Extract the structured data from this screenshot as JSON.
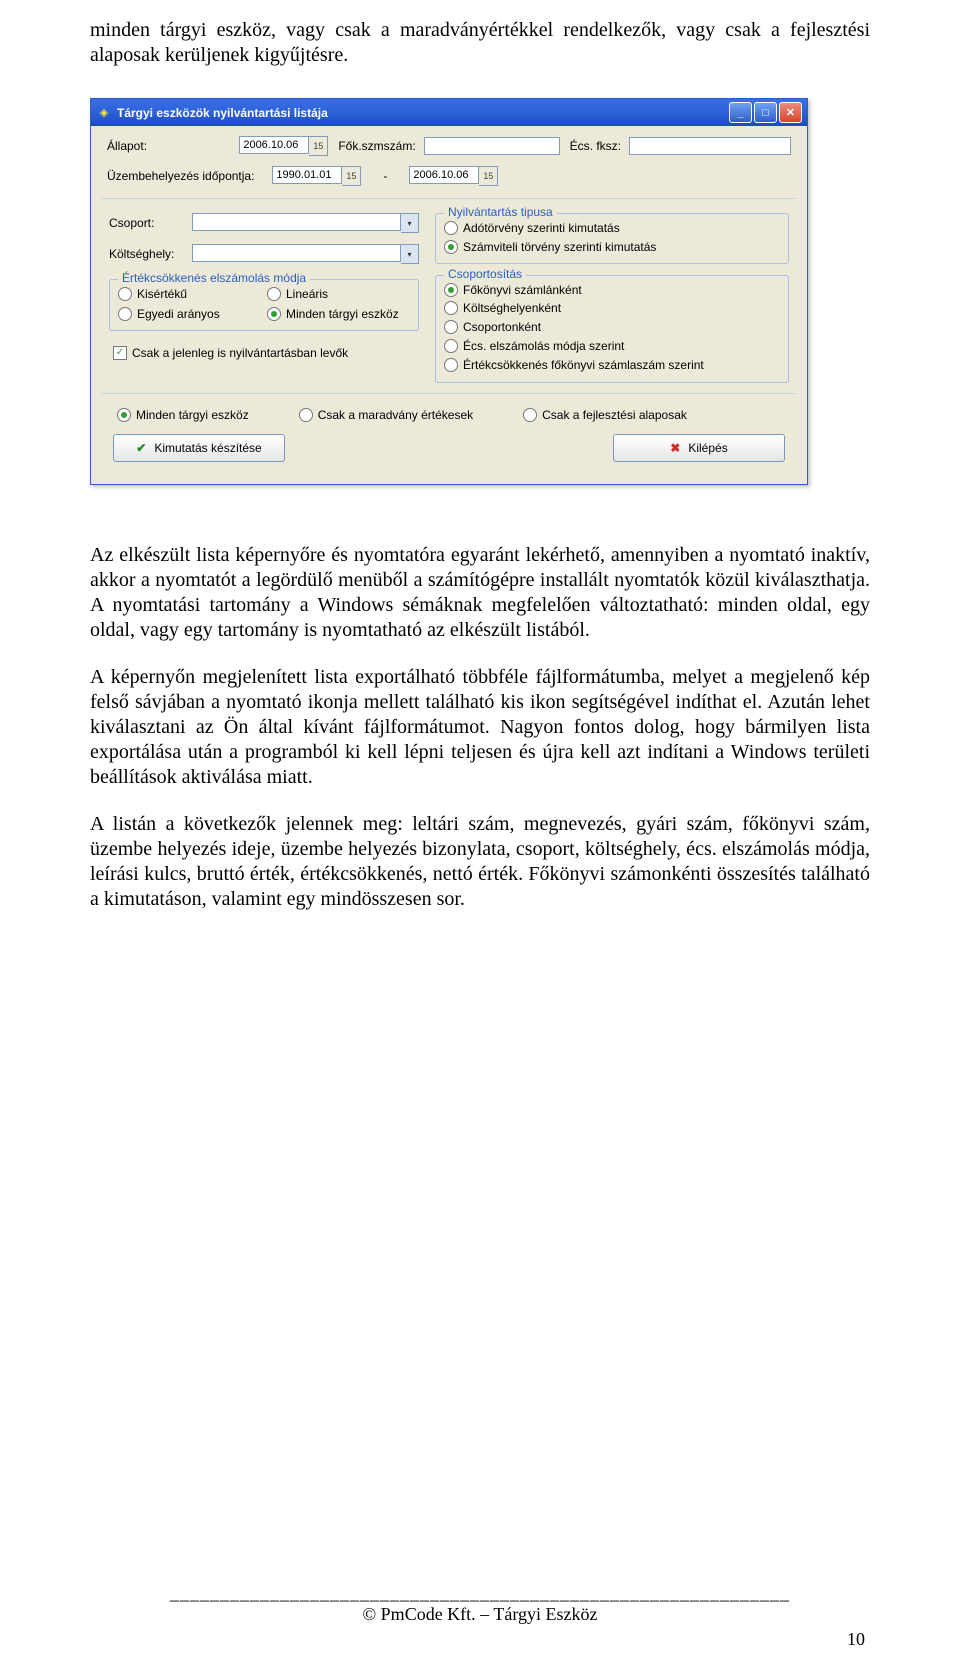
{
  "paragraphs": {
    "p1": "minden tárgyi eszköz, vagy csak a maradványértékkel rendelkezők, vagy csak a fejlesztési alaposak kerüljenek kigyűjtésre.",
    "p2": "Az elkészült lista képernyőre és nyomtatóra egyaránt lekérhető, amennyiben a nyomtató inaktív, akkor a nyomtatót a legördülő menüből a számítógépre installált nyomtatók közül kiválaszthatja. A nyomtatási tartomány a Windows sémáknak megfelelően változtatható: minden oldal, egy oldal, vagy egy tartomány is nyomtatható az elkészült listából.",
    "p3": "A képernyőn megjelenített lista exportálható többféle fájlformátumba, melyet a megjelenő kép felső sávjában a nyomtató ikonja mellett található kis ikon segítségével indíthat el. Azután lehet kiválasztani az Ön által kívánt fájlformátumot. Nagyon fontos dolog, hogy bármilyen lista exportálása után a programból ki kell lépni teljesen és újra kell azt indítani a Windows területi beállítások aktiválása miatt.",
    "p4": "A listán a következők jelennek meg: leltári szám, megnevezés, gyári szám, főkönyvi szám, üzembe helyezés ideje, üzembe helyezés bizonylata, csoport, költséghely, écs. elszámolás módja, leírási kulcs, bruttó érték, értékcsökkenés, nettó érték. Főkönyvi számonkénti összesítés található a kimutatáson, valamint egy mindösszesen sor."
  },
  "window": {
    "title": "Tárgyi eszközök nyilvántartási listája",
    "labels": {
      "allapot": "Állapot:",
      "fokszmszam": "Fők.szmszám:",
      "ecs_fksz": "Écs. fksz:",
      "uzembehelyezes": "Üzembehelyezés időpontja:",
      "sep": "-",
      "csoport": "Csoport:",
      "koltseghely": "Költséghely:"
    },
    "values": {
      "allapot_date": "2006.10.06",
      "uzem_from": "1990.01.01",
      "uzem_to": "2006.10.06"
    },
    "groups": {
      "ecs_modja": {
        "legend": "Értékcsökkenés elszámolás módja",
        "kisertek": "Kisértékű",
        "linearis": "Lineáris",
        "egyedi": "Egyedi arányos",
        "minden": "Minden tárgyi eszköz"
      },
      "nyilvan": {
        "legend": "Nyilvántartás tipusa",
        "ado": "Adótörvény szerinti kimutatás",
        "szamviteli": "Számviteli törvény szerinti kimutatás"
      },
      "csoportositas": {
        "legend": "Csoportosítás",
        "fokonyvi": "Főkönyvi számlánként",
        "koltseghely": "Költséghelyenként",
        "csoport": "Csoportonként",
        "ecsmod": "Écs. elszámolás módja szerint",
        "ecs_fksz": "Értékcsökkenés főkönyvi számlaszám szerint"
      }
    },
    "check_jelenleg": "Csak a jelenleg is nyilvántartásban levők",
    "bottom": {
      "minden": "Minden tárgyi eszköz",
      "maradvany": "Csak a maradvány értékesek",
      "fejlesztesi": "Csak a fejlesztési alaposak"
    },
    "buttons": {
      "keszit": "Kimutatás készítése",
      "kilep": "Kilépés"
    }
  },
  "footer": {
    "divider": "______________________________________________________________",
    "copyright": "© PmCode Kft. – Tárgyi Eszköz",
    "page": "10"
  }
}
